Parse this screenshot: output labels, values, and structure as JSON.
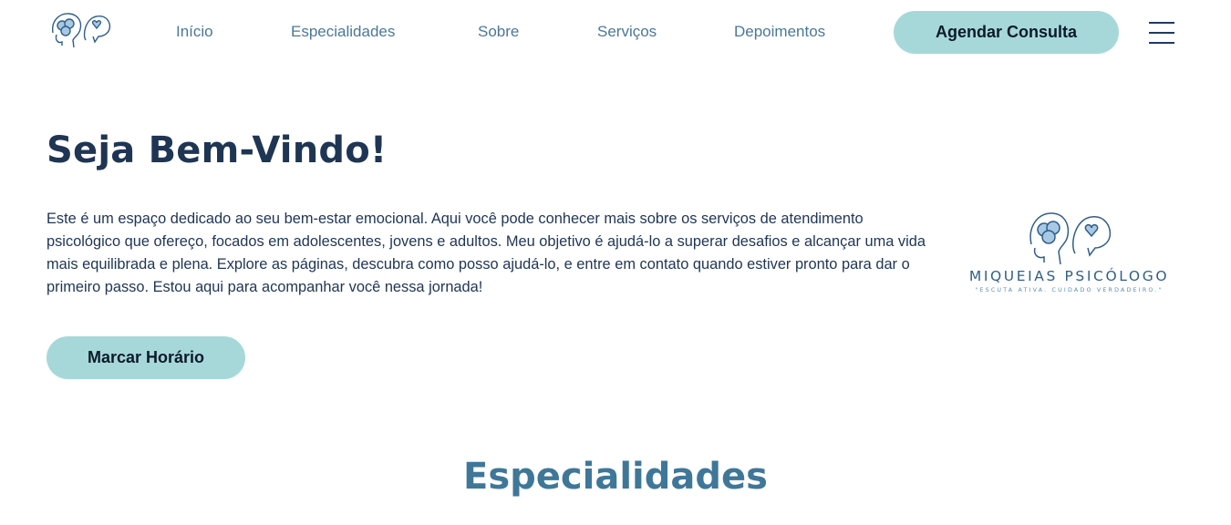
{
  "nav": {
    "logo_icon": "brain-heart-heads-icon",
    "links": [
      "Início",
      "Especialidades",
      "Sobre",
      "Serviços",
      "Depoimentos"
    ],
    "cta_label": "Agendar Consulta",
    "menu_icon": "hamburger-menu-icon"
  },
  "hero": {
    "title": "Seja Bem-Vindo!",
    "text": "Este é um espaço dedicado ao seu bem-estar emocional. Aqui você pode conhecer mais sobre os serviços de atendimento psicológico que ofereço, focados em adolescentes, jovens e adultos. Meu objetivo é ajudá-lo a superar desafios e alcançar uma vida mais equilibrada e plena. Explore as páginas, descubra como posso ajudá-lo, e entre em contato quando estiver pronto para dar o primeiro passo. Estou aqui para acompanhar você nessa jornada!",
    "button_label": "Marcar Horário"
  },
  "brand": {
    "name": "MIQUEIAS PSICÓLOGO",
    "tagline": "\"ESCUTA ATIVA. CUIDADO VERDADEIRO.\""
  },
  "section": {
    "title": "Especialidades"
  },
  "colors": {
    "accent": "#a6d8da",
    "navy": "#1f3554",
    "nav_link": "#4a7899",
    "section_title": "#3f7799"
  }
}
